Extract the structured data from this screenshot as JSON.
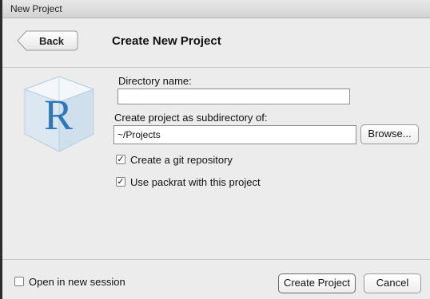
{
  "window": {
    "title": "New Project"
  },
  "header": {
    "back_label": "Back",
    "title": "Create New Project"
  },
  "form": {
    "directory_name": {
      "label": "Directory name:",
      "value": ""
    },
    "subdirectory": {
      "label": "Create project as subdirectory of:",
      "value": "~/Projects",
      "browse_label": "Browse..."
    },
    "options": [
      {
        "label": "Create a git repository",
        "checked": true
      },
      {
        "label": "Use packrat with this project",
        "checked": true
      }
    ]
  },
  "footer": {
    "open_new_session": {
      "label": "Open in new session",
      "checked": false
    },
    "create_label": "Create Project",
    "cancel_label": "Cancel"
  },
  "icons": {
    "logo": "r-cube-logo",
    "check_mark": "✓"
  }
}
